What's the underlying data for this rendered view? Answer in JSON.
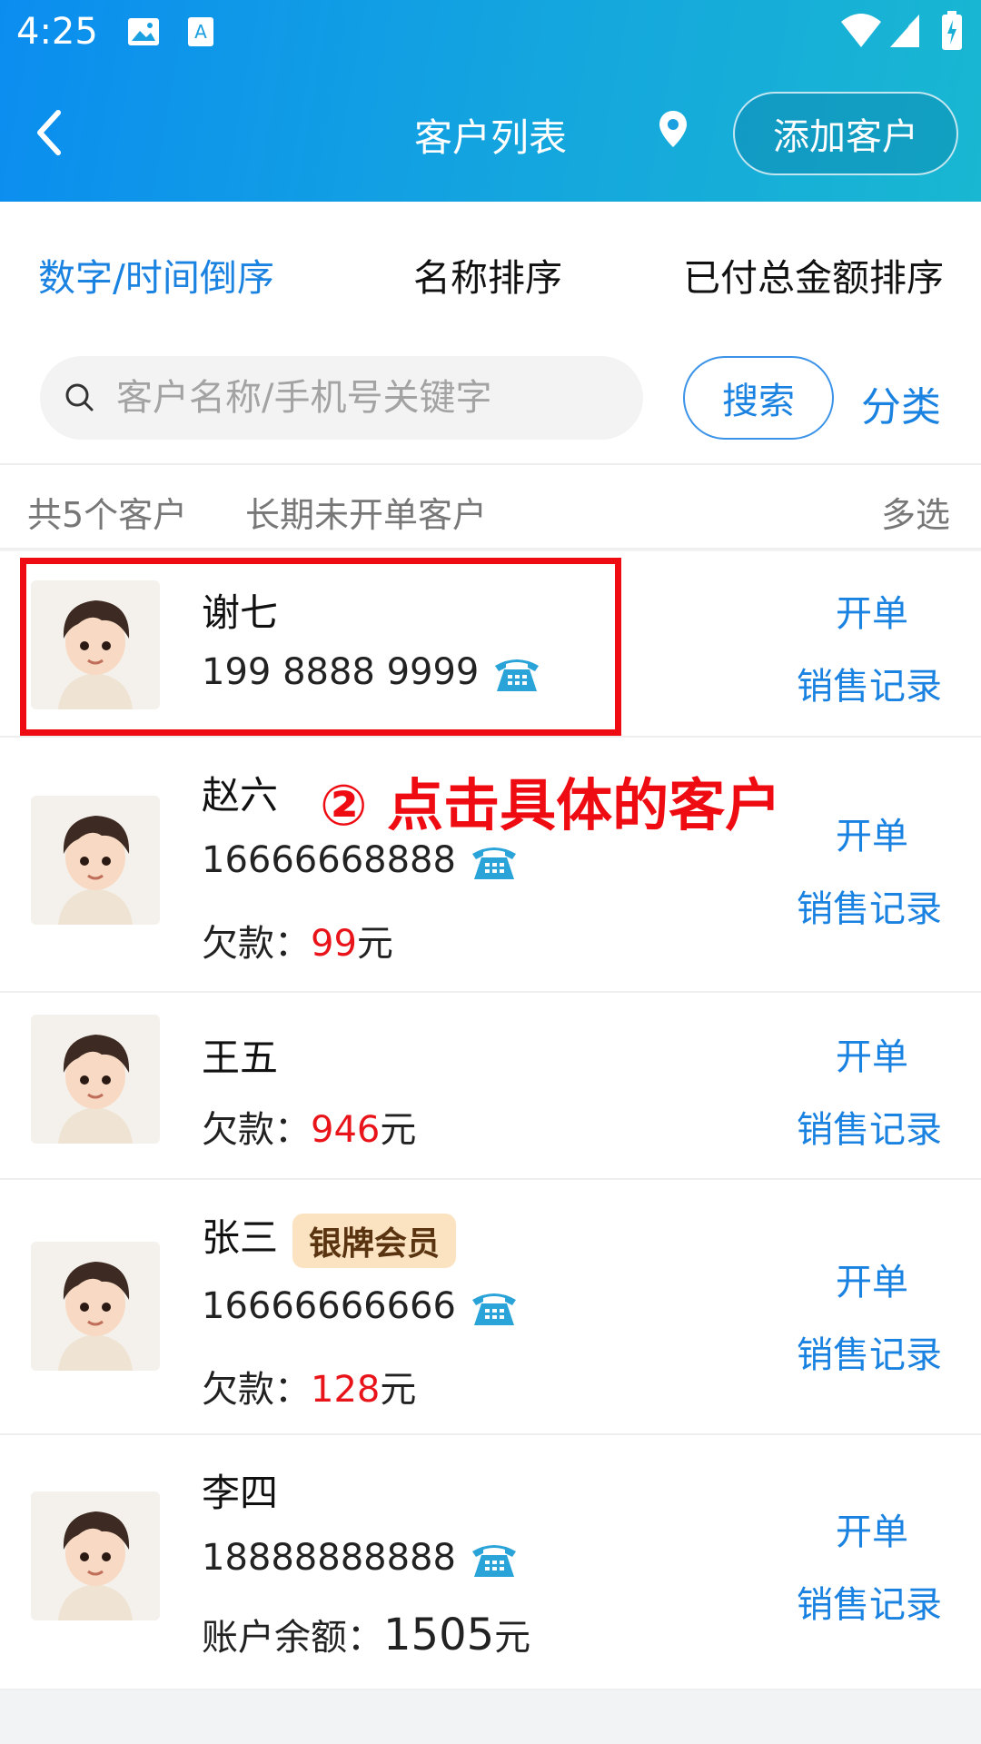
{
  "status_bar": {
    "time": "4:25"
  },
  "header": {
    "title": "客户列表",
    "add_button": "添加客户"
  },
  "sort_tabs": [
    "数字/时间倒序",
    "名称排序",
    "已付总金额排序"
  ],
  "search": {
    "placeholder": "客户名称/手机号关键字",
    "button": "搜索",
    "category": "分类"
  },
  "summary": {
    "count": "共5个客户",
    "inactive": "长期未开单客户",
    "multi": "多选"
  },
  "actions": {
    "open": "开单",
    "sales": "销售记录"
  },
  "customers": [
    {
      "name": "谢七",
      "phone": "199 8888 9999"
    },
    {
      "name": "赵六",
      "phone": "16666668888",
      "debt_label": "欠款：",
      "debt": "99",
      "unit": "元"
    },
    {
      "name": "王五",
      "debt_label": "欠款：",
      "debt": "946",
      "unit": "元"
    },
    {
      "name": "张三",
      "badge": "银牌会员",
      "phone": "16666666666",
      "debt_label": "欠款：",
      "debt": "128",
      "unit": "元"
    },
    {
      "name": "李四",
      "phone": "18888888888",
      "balance_label": "账户余额：",
      "balance": "1505",
      "unit": "元"
    }
  ],
  "annotation": "② 点击具体的客户",
  "colors": {
    "accent": "#1a82e0",
    "header_start": "#0b8df0",
    "header_end": "#19b7d2",
    "debt": "#e8141a",
    "annotation": "#ee0c12"
  }
}
